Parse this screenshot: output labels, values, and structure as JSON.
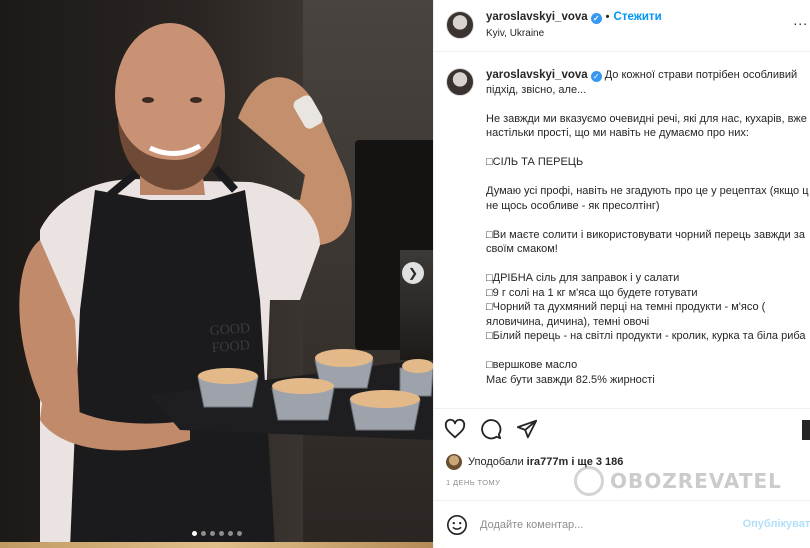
{
  "post": {
    "username": "yaroslavskyi_vova",
    "follow_label": "Стежити",
    "location": "Kyiv, Ukraine",
    "more_label": "...",
    "caption": {
      "lead": "До кожної страви потрібен особливий",
      "lead2": "підхід, звісно, але...",
      "p1a": "Не завжди ми вказуємо очевидні речі, які для нас, кухарів, вже",
      "p1b": "настільки прості, що ми навіть не думаємо про них:",
      "h1": "□СІЛЬ ТА ПЕРЕЦЬ",
      "p2a": "Думаю усі профі, навіть не згадують про це у рецептах (якщо ц",
      "p2b": "не щось особливе - як пресолтінг)",
      "p3a": "□Ви маєте солити і використовувати чорний перець завжди за",
      "p3b": "своїм смаком!",
      "l1": "□ДРІБНА сіль для заправок і у салати",
      "l2": "□9 г солі на 1 кг м'яса що будете готувати",
      "l3a": "□Чорний та духмяний перці на темні продукти - м'ясо (",
      "l3b": "яловичина, дичина), темні овочі",
      "l4": "□Білий перець - на світлі продукти - кролик, курка та біла риба",
      "h2": "□вершкове масло",
      "p4": "Має бути завжди 82.5% жирності"
    },
    "likes": {
      "prefix": "Уподобали",
      "user": "ira777m",
      "suffix": "і ще 3 186"
    },
    "time_ago": "1 ДЕНЬ ТОМУ",
    "watermark": "OBOZREVATEL",
    "comment": {
      "placeholder": "Додайте коментар...",
      "publish_label": "Опублікувати"
    },
    "carousel": {
      "slides": 6,
      "active_index": 0
    }
  }
}
